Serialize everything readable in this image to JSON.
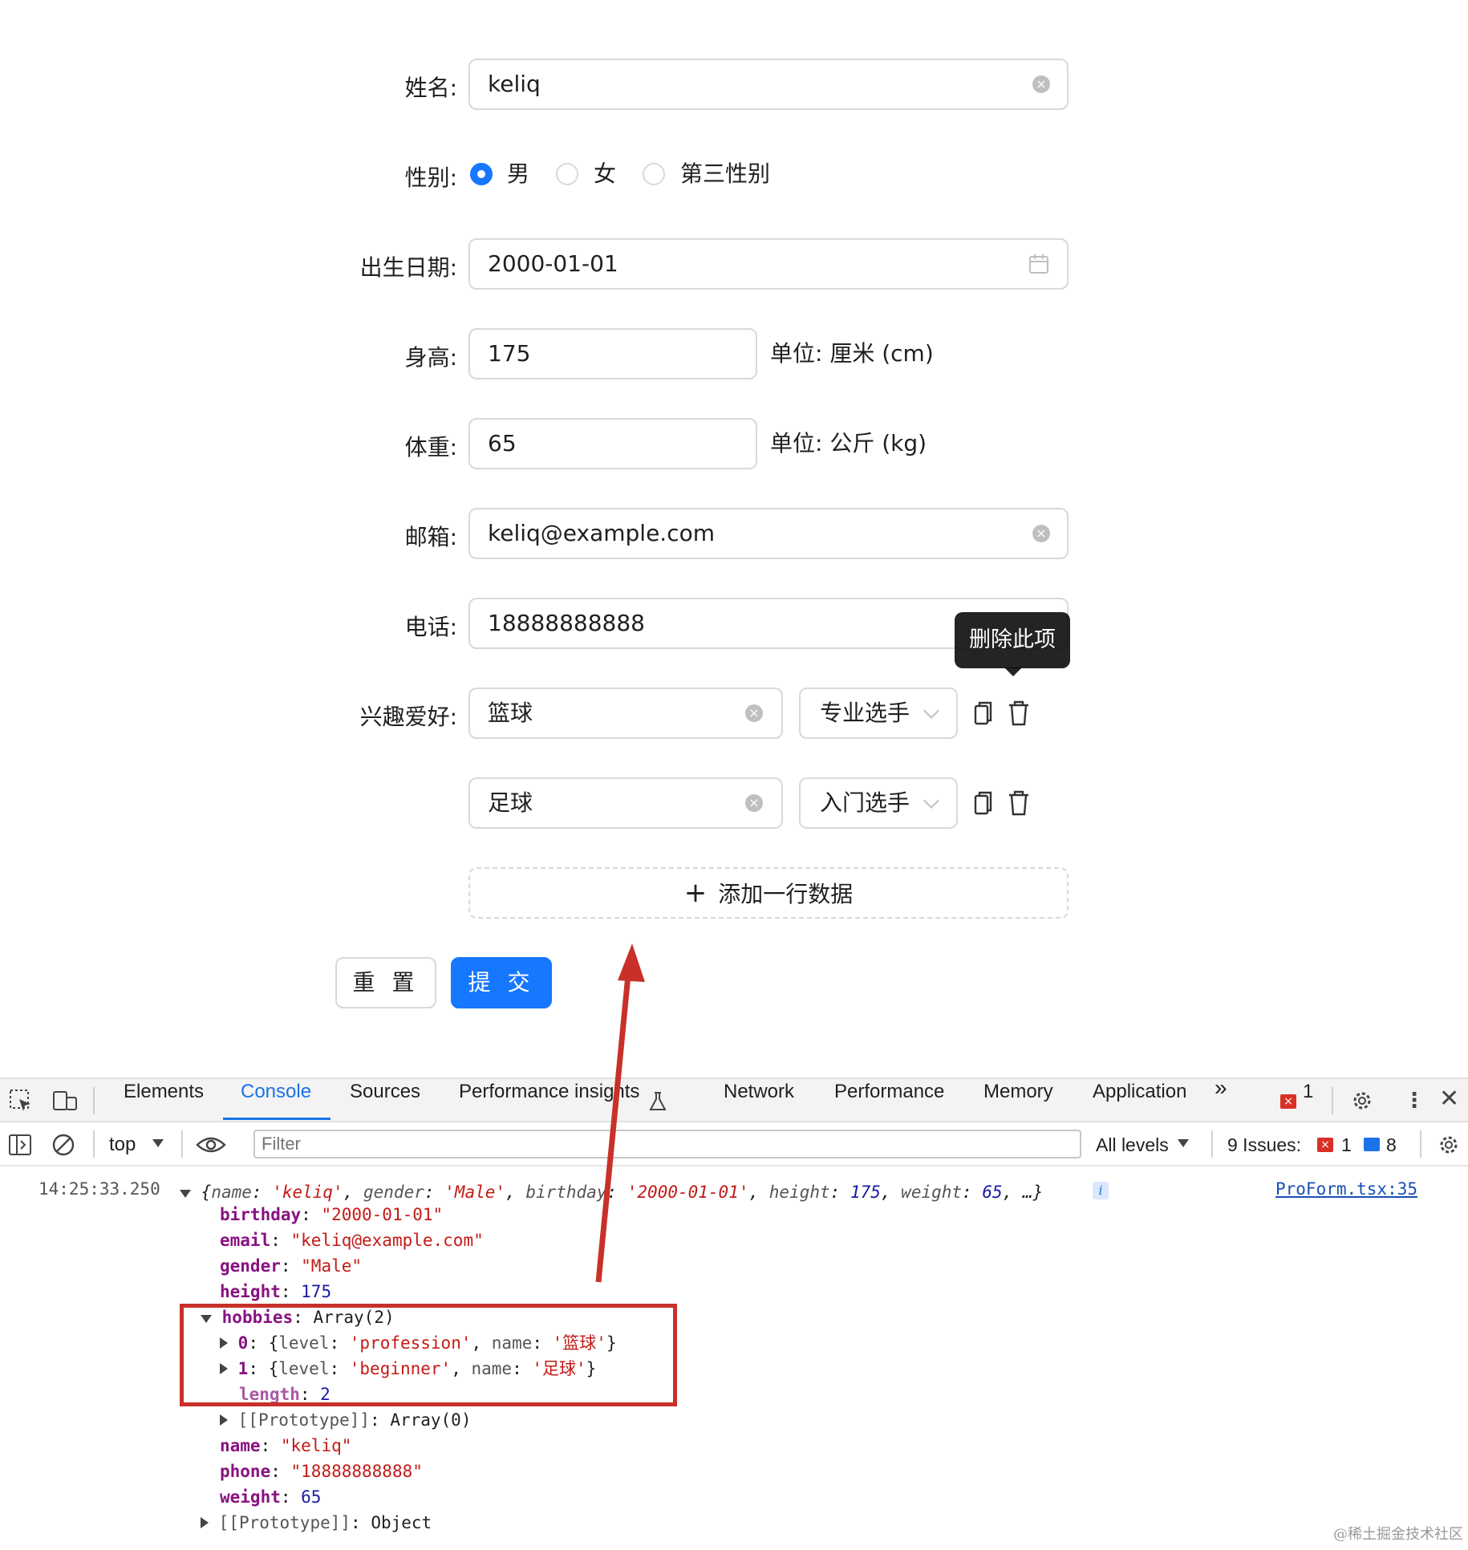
{
  "form": {
    "name": {
      "label": "姓名:",
      "value": "keliq"
    },
    "gender": {
      "label": "性别:",
      "options": [
        "男",
        "女",
        "第三性别"
      ],
      "selected": "男"
    },
    "birthday": {
      "label": "出生日期:",
      "value": "2000-01-01"
    },
    "height": {
      "label": "身高:",
      "value": "175",
      "unit": "单位: 厘米 (cm)"
    },
    "weight": {
      "label": "体重:",
      "value": "65",
      "unit": "单位: 公斤 (kg)"
    },
    "email": {
      "label": "邮箱:",
      "value": "keliq@example.com"
    },
    "phone": {
      "label": "电话:",
      "value": "18888888888"
    },
    "hobbies": {
      "label": "兴趣爱好:",
      "rows": [
        {
          "name": "篮球",
          "level": "专业选手"
        },
        {
          "name": "足球",
          "level": "入门选手"
        }
      ],
      "add_label": "添加一行数据",
      "tooltip": "删除此项"
    },
    "reset_label": "重 置",
    "submit_label": "提 交",
    "colors": {
      "primary": "#1677ff",
      "annotation": "#c8302a"
    }
  },
  "devtools": {
    "tabs": [
      "Elements",
      "Console",
      "Sources",
      "Performance insights",
      "Network",
      "Performance",
      "Memory",
      "Application"
    ],
    "active_tab": "Console",
    "error_badge": "1",
    "context": "top",
    "filter_placeholder": "Filter",
    "levels": "All levels",
    "issues_label": "9 Issues:",
    "issues_errors": "1",
    "issues_info": "8",
    "log": {
      "timestamp": "14:25:33.250",
      "source": "ProForm.tsx:35",
      "summary": {
        "name": "'keliq'",
        "gender": "'Male'",
        "birthday": "'2000-01-01'",
        "height": "175",
        "weight": "65",
        "more": "…}"
      },
      "birthday": "\"2000-01-01\"",
      "email": "\"keliq@example.com\"",
      "gender": "\"Male\"",
      "height": "175",
      "hobbies_type": "Array(2)",
      "hobby0": {
        "level": "'profession'",
        "name": "'篮球'"
      },
      "hobby1": {
        "level": "'beginner'",
        "name": "'足球'"
      },
      "length": "2",
      "array_proto": "Array(0)",
      "name": "\"keliq\"",
      "phone": "\"18888888888\"",
      "weight": "65",
      "obj_proto": "Object"
    }
  },
  "watermark": "@稀土掘金技术社区"
}
